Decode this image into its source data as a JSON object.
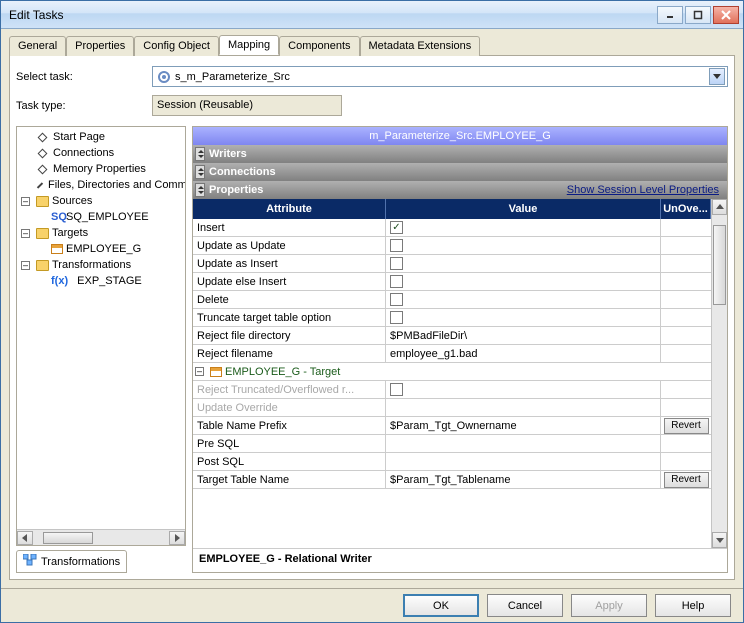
{
  "window": {
    "title": "Edit Tasks"
  },
  "tabs": [
    "General",
    "Properties",
    "Config Object",
    "Mapping",
    "Components",
    "Metadata Extensions"
  ],
  "active_tab": "Mapping",
  "select_task": {
    "label": "Select task:",
    "value": "s_m_Parameterize_Src"
  },
  "task_type": {
    "label": "Task type:",
    "value": "Session (Reusable)"
  },
  "tree": {
    "items": [
      {
        "label": "Start Page",
        "type": "diamond",
        "indent": 1
      },
      {
        "label": "Connections",
        "type": "diamond",
        "indent": 1
      },
      {
        "label": "Memory Properties",
        "type": "diamond",
        "indent": 1
      },
      {
        "label": "Files, Directories and Commands",
        "type": "diamond",
        "indent": 1
      },
      {
        "label": "Sources",
        "type": "folder",
        "indent": 0,
        "exp": "-"
      },
      {
        "label": "SQ_EMPLOYEE",
        "type": "sq",
        "indent": 1
      },
      {
        "label": "Targets",
        "type": "folder",
        "indent": 0,
        "exp": "-"
      },
      {
        "label": "EMPLOYEE_G",
        "type": "target",
        "indent": 1
      },
      {
        "label": "Transformations",
        "type": "folder",
        "indent": 0,
        "exp": "-"
      },
      {
        "label": "EXP_STAGE",
        "type": "fx",
        "indent": 1
      }
    ]
  },
  "left_bottom_tab": "Transformations",
  "right": {
    "header": "m_Parameterize_Src.EMPLOYEE_G",
    "writers": "Writers",
    "connections": "Connections",
    "properties": "Properties",
    "show_link": "Show Session Level Properties",
    "columns": {
      "attr": "Attribute",
      "value": "Value",
      "un": "UnOve..."
    },
    "rows": [
      {
        "attr": "Insert",
        "kind": "check",
        "checked": true
      },
      {
        "attr": "Update as Update",
        "kind": "check",
        "checked": false
      },
      {
        "attr": "Update as Insert",
        "kind": "check",
        "checked": false
      },
      {
        "attr": "Update else Insert",
        "kind": "check",
        "checked": false
      },
      {
        "attr": "Delete",
        "kind": "check",
        "checked": false
      },
      {
        "attr": "Truncate target table option",
        "kind": "check",
        "checked": false
      },
      {
        "attr": "Reject file directory",
        "kind": "text",
        "value": "$PMBadFileDir\\"
      },
      {
        "attr": "Reject filename",
        "kind": "text",
        "value": "employee_g1.bad"
      }
    ],
    "grouprow": "EMPLOYEE_G - Target",
    "rows2": [
      {
        "attr": "Reject Truncated/Overflowed r...",
        "kind": "check",
        "checked": false,
        "disabled": true
      },
      {
        "attr": "Update Override",
        "kind": "text",
        "value": "",
        "disabled": true
      },
      {
        "attr": "Table Name Prefix",
        "kind": "text",
        "value": "$Param_Tgt_Ownername",
        "revert": true
      },
      {
        "attr": "Pre SQL",
        "kind": "text",
        "value": ""
      },
      {
        "attr": "Post SQL",
        "kind": "text",
        "value": ""
      },
      {
        "attr": "Target Table Name",
        "kind": "text",
        "value": "$Param_Tgt_Tablename",
        "revert": true
      }
    ],
    "revert_label": "Revert",
    "status": "EMPLOYEE_G - Relational Writer"
  },
  "buttons": {
    "ok": "OK",
    "cancel": "Cancel",
    "apply": "Apply",
    "help": "Help"
  }
}
